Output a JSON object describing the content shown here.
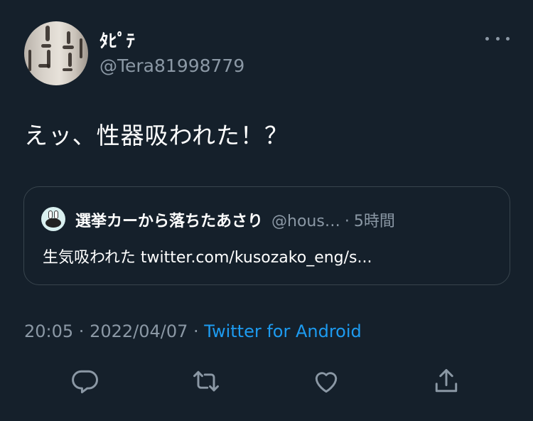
{
  "author": {
    "display_name": "ﾀﾋﾟﾃ",
    "handle": "@Tera81998779"
  },
  "tweet": {
    "text": "えッ、性器吸われた！？"
  },
  "quote": {
    "display_name": "選挙カーから落ちたあさり",
    "handle": "@hous…",
    "separator": "·",
    "time": "5時間",
    "text": "生気吸われた twitter.com/kusozako_eng/s..."
  },
  "meta": {
    "time": "20:05",
    "separator1": " · ",
    "date": "2022/04/07",
    "separator2": " · ",
    "source": "Twitter for Android"
  },
  "icons": {
    "more": "more-icon",
    "reply": "reply-icon",
    "retweet": "retweet-icon",
    "like": "heart-icon",
    "share": "share-icon"
  },
  "colors": {
    "background": "#15202b",
    "secondary_text": "#8b98a5",
    "link": "#1d9bf0",
    "border": "#38444d"
  }
}
